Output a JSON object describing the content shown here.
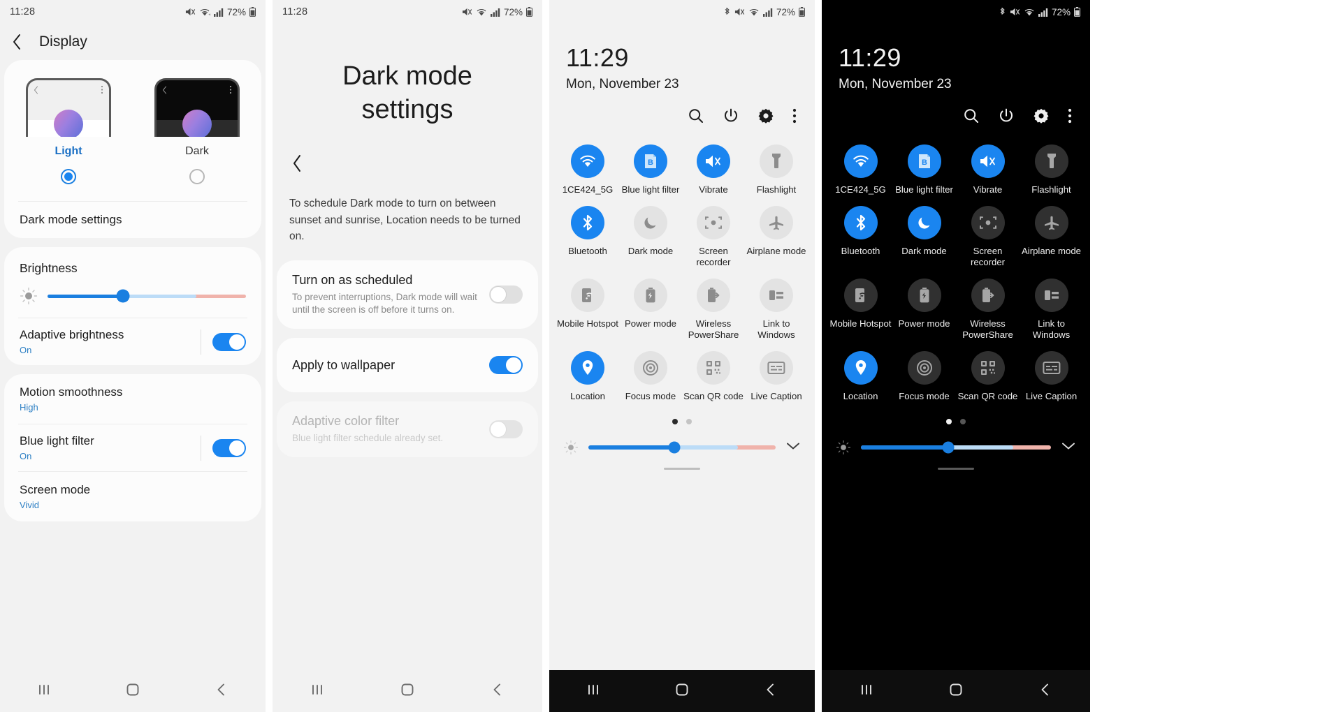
{
  "panel1": {
    "statusbar": {
      "time": "11:28",
      "battery": "72%",
      "icons": [
        "mute-icon",
        "wifi-icon",
        "signal-icon",
        "battery-icon"
      ]
    },
    "appbar": {
      "title": "Display",
      "back_icon": "chevron-left-icon"
    },
    "theme": {
      "light_label": "Light",
      "dark_label": "Dark",
      "selected": "Light"
    },
    "dark_mode_settings_label": "Dark mode settings",
    "brightness": {
      "title": "Brightness",
      "value": 38
    },
    "adaptive_brightness": {
      "label": "Adaptive brightness",
      "value": "On",
      "enabled": true
    },
    "motion_smoothness": {
      "label": "Motion smoothness",
      "value": "High"
    },
    "blue_light_filter": {
      "label": "Blue light filter",
      "value": "On",
      "enabled": true
    },
    "screen_mode": {
      "label": "Screen mode",
      "value": "Vivid"
    },
    "nav": {
      "recents": "recents-icon",
      "home": "home-icon",
      "back": "back-icon"
    }
  },
  "panel2": {
    "statusbar": {
      "time": "11:28",
      "battery": "72%"
    },
    "title": "Dark mode settings",
    "back_icon": "chevron-left-icon",
    "description": "To schedule Dark mode to turn on between sunset and sunrise, Location needs to be turned on.",
    "rows": [
      {
        "title": "Turn on as scheduled",
        "desc": "To prevent interruptions, Dark mode will wait until the screen is off before it turns on.",
        "toggle": "off",
        "disabled": false
      },
      {
        "title": "Apply to wallpaper",
        "desc": "",
        "toggle": "on",
        "disabled": false
      },
      {
        "title": "Adaptive color filter",
        "desc": "Blue light filter schedule already set.",
        "toggle": "disabled",
        "disabled": true
      }
    ]
  },
  "panel3": {
    "statusbar": {
      "battery": "72%",
      "icons": [
        "bluetooth-icon",
        "mute-icon",
        "wifi-icon",
        "signal-icon",
        "battery-icon"
      ]
    },
    "clock": {
      "time": "11:29",
      "date": "Mon, November 23"
    },
    "actions": [
      "search-icon",
      "power-icon",
      "gear-icon",
      "more-vertical-icon"
    ],
    "tiles": [
      {
        "label": "1CE424_5G",
        "icon": "wifi-icon",
        "state": "on"
      },
      {
        "label": "Blue light filter",
        "icon": "blue-light-filter-icon",
        "state": "on"
      },
      {
        "label": "Vibrate",
        "icon": "vibrate-icon",
        "state": "on"
      },
      {
        "label": "Flashlight",
        "icon": "flashlight-icon",
        "state": "off"
      },
      {
        "label": "Bluetooth",
        "icon": "bluetooth-icon",
        "state": "on"
      },
      {
        "label": "Dark mode",
        "icon": "moon-icon",
        "state": "off"
      },
      {
        "label": "Screen recorder",
        "icon": "screen-recorder-icon",
        "state": "off"
      },
      {
        "label": "Airplane mode",
        "icon": "airplane-icon",
        "state": "off"
      },
      {
        "label": "Mobile Hotspot",
        "icon": "hotspot-icon",
        "state": "off"
      },
      {
        "label": "Power mode",
        "icon": "power-mode-icon",
        "state": "off"
      },
      {
        "label": "Wireless PowerShare",
        "icon": "wireless-powershare-icon",
        "state": "off"
      },
      {
        "label": "Link to Windows",
        "icon": "link-to-windows-icon",
        "state": "off"
      },
      {
        "label": "Location",
        "icon": "location-icon",
        "state": "on"
      },
      {
        "label": "Focus mode",
        "icon": "focus-mode-icon",
        "state": "off"
      },
      {
        "label": "Scan QR code",
        "icon": "qr-code-icon",
        "state": "off"
      },
      {
        "label": "Live Caption",
        "icon": "live-caption-icon",
        "state": "off"
      }
    ],
    "pager": {
      "pages": 2,
      "active": 0
    },
    "brightness": {
      "value": 46,
      "expand_icon": "chevron-down-icon"
    }
  },
  "panel4": {
    "statusbar": {
      "battery": "72%",
      "icons": [
        "bluetooth-icon",
        "mute-icon",
        "wifi-icon",
        "signal-icon",
        "battery-icon"
      ]
    },
    "clock": {
      "time": "11:29",
      "date": "Mon, November 23"
    },
    "actions": [
      "search-icon",
      "power-icon",
      "gear-icon",
      "more-vertical-icon"
    ],
    "tiles": [
      {
        "label": "1CE424_5G",
        "icon": "wifi-icon",
        "state": "on"
      },
      {
        "label": "Blue light filter",
        "icon": "blue-light-filter-icon",
        "state": "on"
      },
      {
        "label": "Vibrate",
        "icon": "vibrate-icon",
        "state": "on"
      },
      {
        "label": "Flashlight",
        "icon": "flashlight-icon",
        "state": "off"
      },
      {
        "label": "Bluetooth",
        "icon": "bluetooth-icon",
        "state": "on"
      },
      {
        "label": "Dark mode",
        "icon": "moon-icon",
        "state": "on"
      },
      {
        "label": "Screen recorder",
        "icon": "screen-recorder-icon",
        "state": "off"
      },
      {
        "label": "Airplane mode",
        "icon": "airplane-icon",
        "state": "off"
      },
      {
        "label": "Mobile Hotspot",
        "icon": "hotspot-icon",
        "state": "off"
      },
      {
        "label": "Power mode",
        "icon": "power-mode-icon",
        "state": "off"
      },
      {
        "label": "Wireless PowerShare",
        "icon": "wireless-powershare-icon",
        "state": "off"
      },
      {
        "label": "Link to Windows",
        "icon": "link-to-windows-icon",
        "state": "off"
      },
      {
        "label": "Location",
        "icon": "location-icon",
        "state": "on"
      },
      {
        "label": "Focus mode",
        "icon": "focus-mode-icon",
        "state": "off"
      },
      {
        "label": "Scan QR code",
        "icon": "qr-code-icon",
        "state": "off"
      },
      {
        "label": "Live Caption",
        "icon": "live-caption-icon",
        "state": "off"
      }
    ],
    "pager": {
      "pages": 2,
      "active": 0
    },
    "brightness": {
      "value": 46,
      "expand_icon": "chevron-down-icon"
    }
  },
  "colors": {
    "accent": "#1a85f0",
    "accent_dark": "#1a7fe0",
    "link": "#2e80c4",
    "warm": "#f0b3ab"
  }
}
